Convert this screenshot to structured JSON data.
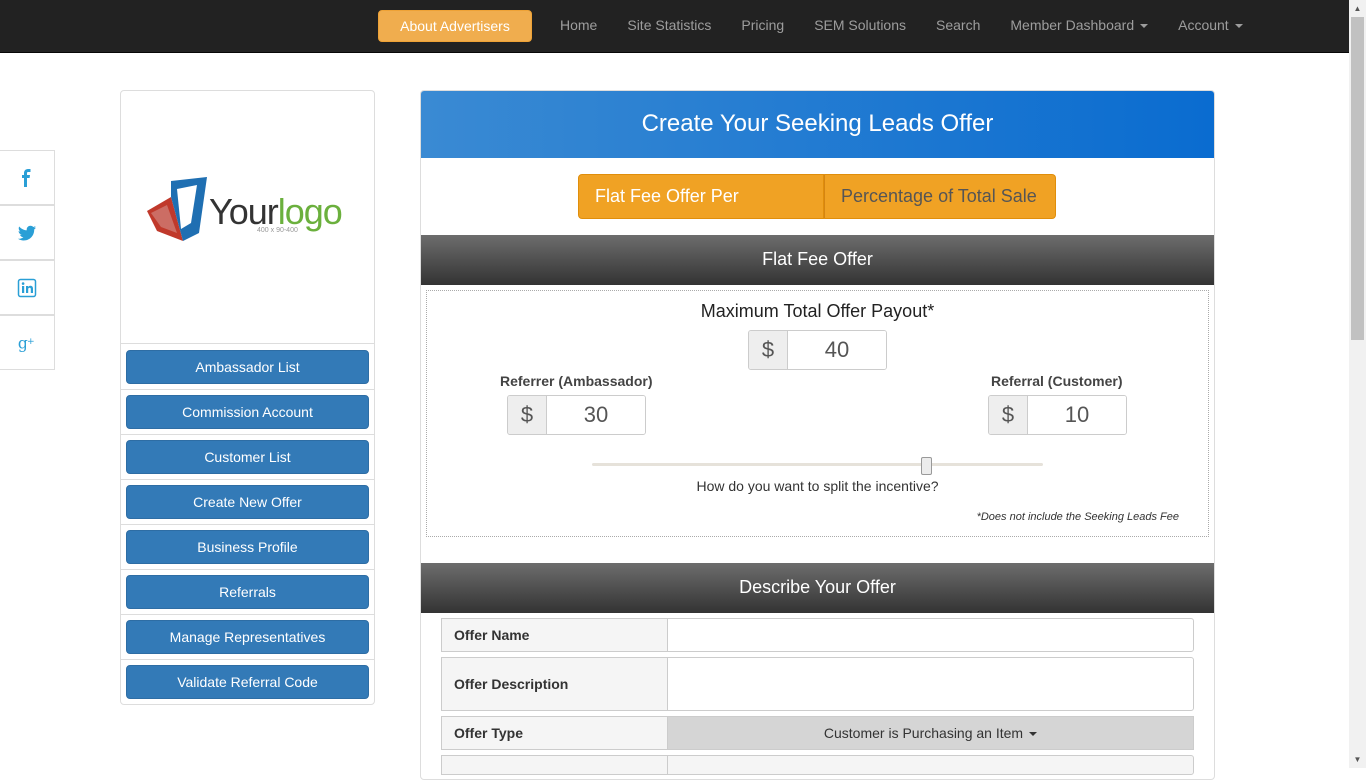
{
  "navbar": {
    "cta": "About Advertisers",
    "links": [
      "Home",
      "Site Statistics",
      "Pricing",
      "SEM Solutions",
      "Search"
    ],
    "member_dashboard": "Member Dashboard",
    "account": "Account"
  },
  "social": [
    "facebook-icon",
    "twitter-icon",
    "linkedin-icon",
    "google-plus-icon"
  ],
  "logo": {
    "your": "Your",
    "logo": "logo",
    "sub": "400 x 90-400"
  },
  "sidebar": {
    "items": [
      "Ambassador List",
      "Commission Account",
      "Customer List",
      "Create New Offer",
      "Business Profile",
      "Referrals",
      "Manage Representatives",
      "Validate Referral Code"
    ]
  },
  "panel": {
    "title": "Create Your Seeking Leads Offer",
    "toggle": {
      "flat": "Flat Fee Offer Per Referral",
      "percent": "Percentage of Total Sale"
    },
    "flat_fee": {
      "heading": "Flat Fee Offer",
      "max_label": "Maximum Total Offer Payout*",
      "currency": "$",
      "max_value": "40",
      "referrer_label": "Referrer (Ambassador)",
      "referrer_value": "30",
      "referral_label": "Referral (Customer)",
      "referral_value": "10",
      "split_question": "How do you want to split the incentive?",
      "fee_note": "*Does not include the Seeking Leads Fee"
    },
    "describe": {
      "heading": "Describe Your Offer",
      "offer_name_label": "Offer Name",
      "offer_description_label": "Offer Description",
      "offer_type_label": "Offer Type",
      "offer_type_value": "Customer is Purchasing an Item"
    }
  },
  "colors": {
    "brand_blue": "#337ab7",
    "orange": "#f0a224",
    "navbar": "#222222"
  }
}
